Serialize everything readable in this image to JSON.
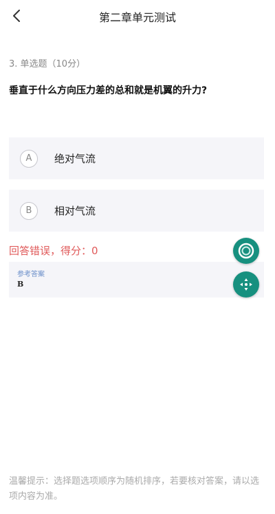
{
  "header": {
    "title": "第二章单元测试"
  },
  "question": {
    "meta": "3. 单选题（10分）",
    "text": "垂直于什么方向压力差的总和就是机翼的升力?",
    "options": [
      {
        "letter": "A",
        "text": "绝对气流"
      },
      {
        "letter": "B",
        "text": "相对气流"
      }
    ]
  },
  "result": {
    "status": "回答错误，",
    "score_label": "得分：",
    "score": "0"
  },
  "answer": {
    "label": "参考答案",
    "value": "B"
  },
  "tip": {
    "text": "温馨提示：选择题选项顺序为随机排序，若要核对答案，请以选项内容为准。"
  },
  "colors": {
    "accent": "#17907f",
    "error": "#e05a5a",
    "option_bg": "#f5f5f9",
    "answer_label": "#6a8ec9"
  },
  "icons": {
    "back": "chevron-left-icon",
    "fab_top": "ring-icon",
    "fab_bottom": "move-cross-icon"
  }
}
